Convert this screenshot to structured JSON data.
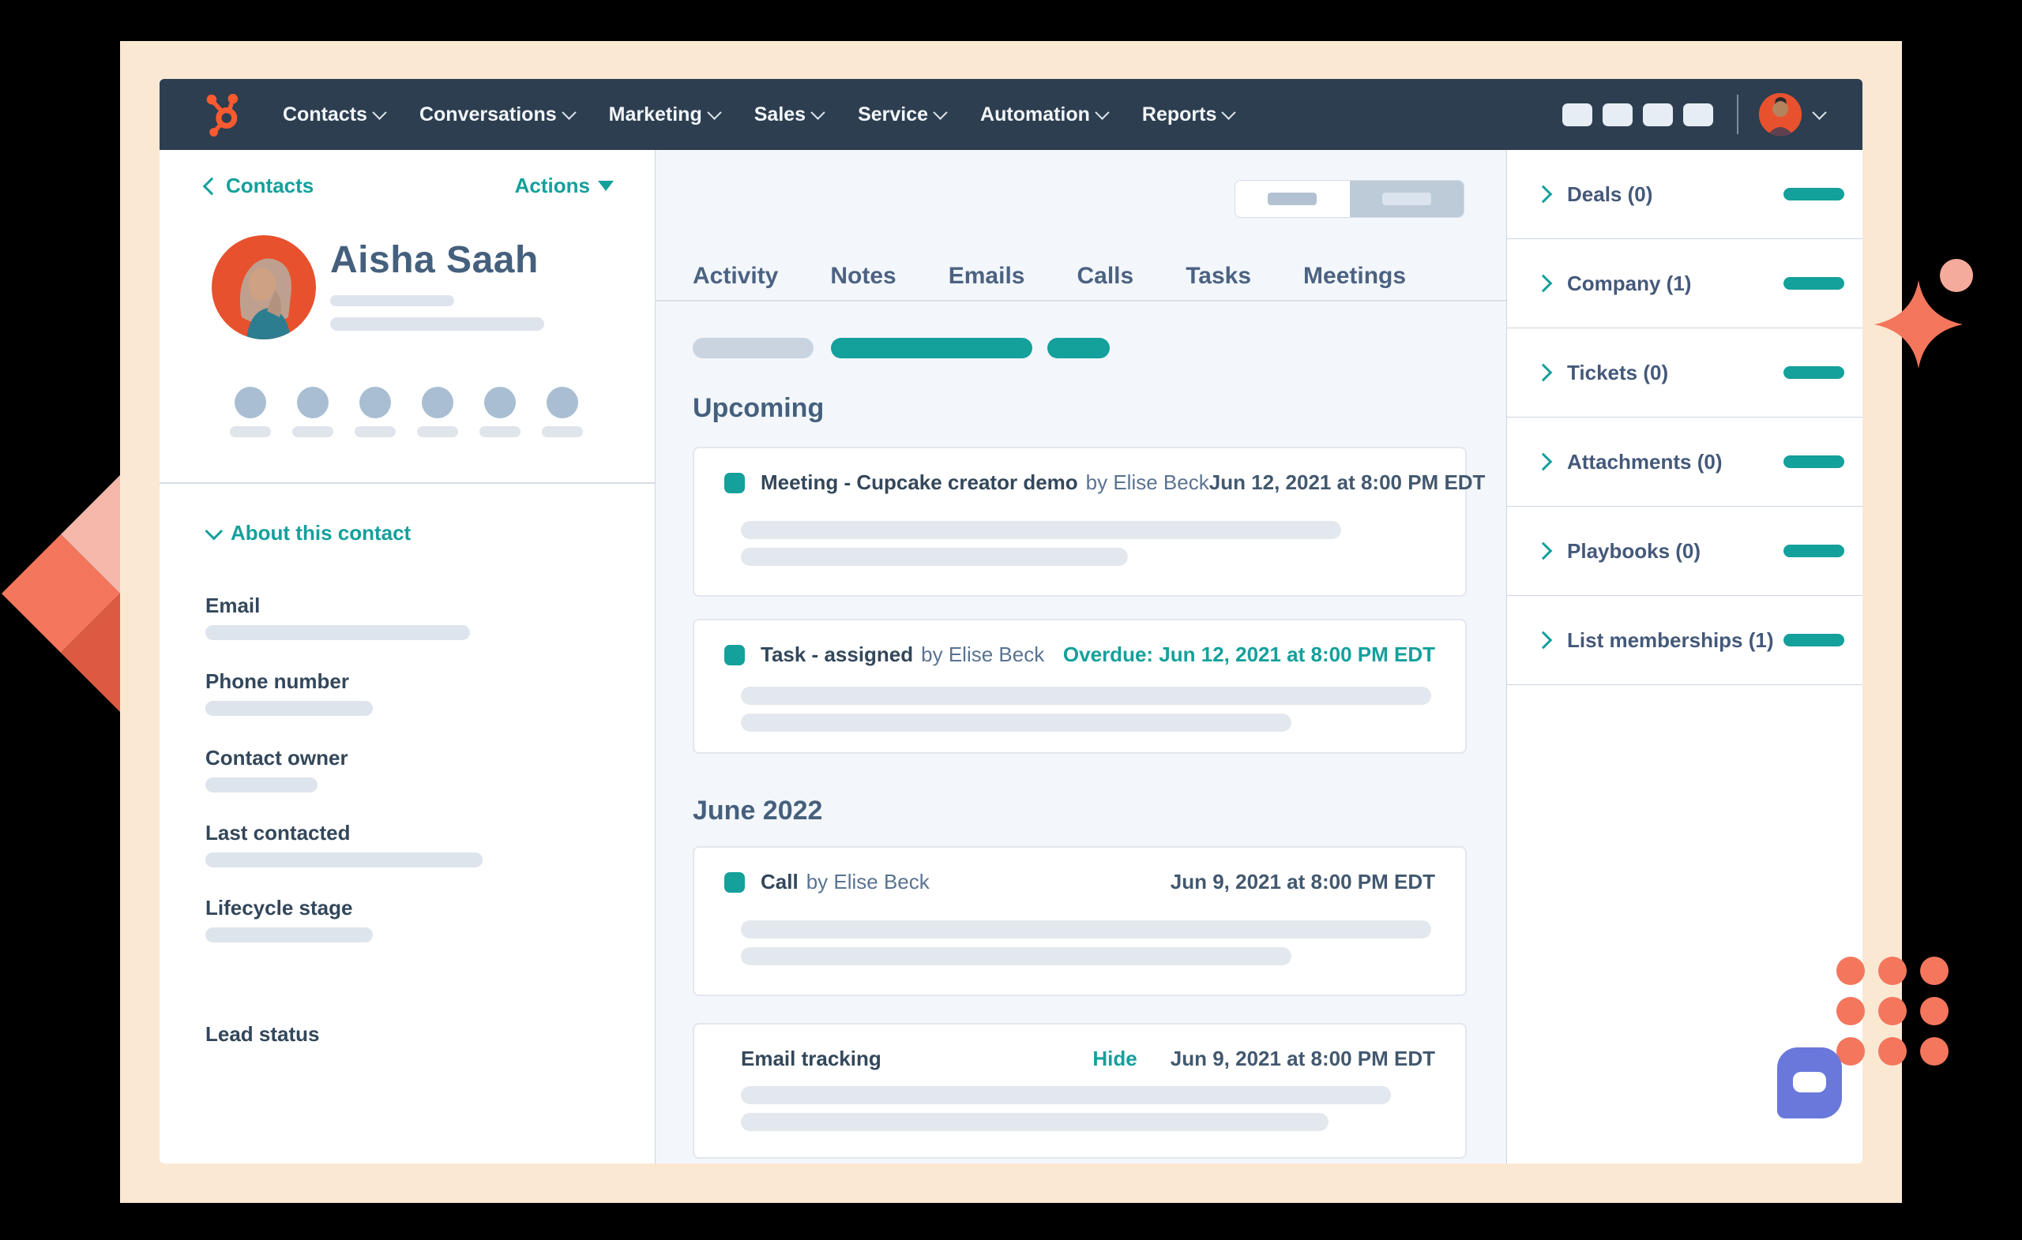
{
  "nav": {
    "logo": "hubspot-sprocket",
    "items": [
      {
        "label": "Contacts"
      },
      {
        "label": "Conversations"
      },
      {
        "label": "Marketing"
      },
      {
        "label": "Sales"
      },
      {
        "label": "Service"
      },
      {
        "label": "Automation"
      },
      {
        "label": "Reports"
      }
    ]
  },
  "contact": {
    "breadcrumb_label": "Contacts",
    "actions_label": "Actions",
    "name": "Aisha Saah",
    "about_title": "About this contact",
    "fields": [
      {
        "label": "Email"
      },
      {
        "label": "Phone number"
      },
      {
        "label": "Contact owner"
      },
      {
        "label": "Last contacted"
      },
      {
        "label": "Lifecycle stage"
      },
      {
        "label": "Lead status"
      }
    ]
  },
  "main": {
    "tabs": [
      {
        "label": "Activity"
      },
      {
        "label": "Notes"
      },
      {
        "label": "Emails"
      },
      {
        "label": "Calls"
      },
      {
        "label": "Tasks"
      },
      {
        "label": "Meetings"
      }
    ],
    "sections": {
      "upcoming_heading": "Upcoming",
      "june_heading": "June 2022"
    },
    "cards": {
      "meeting": {
        "title": "Meeting - Cupcake creator demo",
        "byline": "by Elise Beck",
        "timestamp": "Jun 12, 2021 at 8:00 PM EDT"
      },
      "task": {
        "title": "Task - assigned",
        "byline": "by Elise Beck",
        "timestamp": "Overdue: Jun 12, 2021 at 8:00 PM EDT"
      },
      "call": {
        "title": "Call",
        "byline": "by Elise Beck",
        "timestamp": "Jun 9, 2021 at 8:00 PM EDT"
      },
      "email": {
        "title": "Email tracking",
        "hide_label": "Hide",
        "timestamp": "Jun 9, 2021 at 8:00 PM EDT"
      }
    }
  },
  "associations": {
    "items": [
      {
        "label": "Deals (0)"
      },
      {
        "label": "Company (1)"
      },
      {
        "label": "Tickets (0)"
      },
      {
        "label": "Attachments (0)"
      },
      {
        "label": "Playbooks (0)"
      },
      {
        "label": "List memberships (1)"
      }
    ]
  },
  "colors": {
    "accent_teal": "#14a09b",
    "navy": "#2d3e50",
    "coral": "#f4765c",
    "peach": "#fbe8d3",
    "purple_chat": "#6a78dc",
    "slate_text": "#33475b",
    "logo_orange": "#fa5a30"
  }
}
